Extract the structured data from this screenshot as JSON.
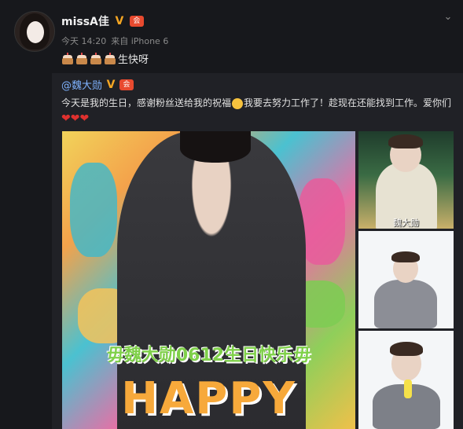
{
  "post": {
    "username": "missA佳",
    "time": "今天 14:20",
    "source": "来自 iPhone 6",
    "text": "生快呀",
    "cake_count": 4
  },
  "repost": {
    "username": "@魏大勋",
    "text": "今天是我的生日，感谢粉丝送给我的祝福",
    "text2": "我要去努力工作了！趁现在还能找到工作。爱你们",
    "hearts": "❤❤❤"
  },
  "images": {
    "main_banner": "毋魏大勋0612生日快乐毋",
    "main_happy": "HAPPY",
    "thumb1_watermark": "魏大勋"
  },
  "icons": {
    "verified": "V",
    "member": "会",
    "chevron": "⌄"
  }
}
